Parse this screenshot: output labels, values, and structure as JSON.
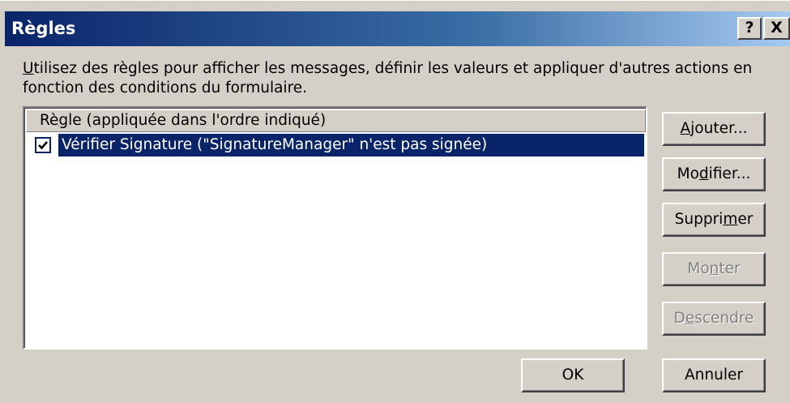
{
  "window": {
    "title": "Règles",
    "help_label": "?",
    "close_label": "X"
  },
  "description": {
    "first_char": "U",
    "rest": "tilisez des règles pour afficher les messages, définir les valeurs et appliquer d'autres actions en fonction des conditions du formulaire."
  },
  "list": {
    "header_pre": "Rè",
    "header_mnemonic": "g",
    "header_post": "le (appliquée dans l'ordre indiqué)",
    "rows": [
      {
        "label": "Vérifier Signature (\"SignatureManager\" n'est pas signée)",
        "checked": true,
        "selected": true
      }
    ]
  },
  "buttons": {
    "add": {
      "pre": "",
      "mnemonic": "A",
      "post": "jouter..."
    },
    "modify": {
      "pre": "Mo",
      "mnemonic": "d",
      "post": "ifier..."
    },
    "delete": {
      "pre": "Suppri",
      "mnemonic": "m",
      "post": "er"
    },
    "up": {
      "pre": "Mo",
      "mnemonic": "n",
      "post": "ter",
      "enabled": false
    },
    "down": {
      "pre": "D",
      "mnemonic": "e",
      "post": "scendre",
      "enabled": false
    },
    "ok": "OK",
    "cancel": "Annuler"
  },
  "colors": {
    "title_gradient_start": "#0a246a",
    "title_gradient_end": "#a6caf0",
    "selection": "#0a246a",
    "dialog_bg": "#d4d0c8"
  }
}
